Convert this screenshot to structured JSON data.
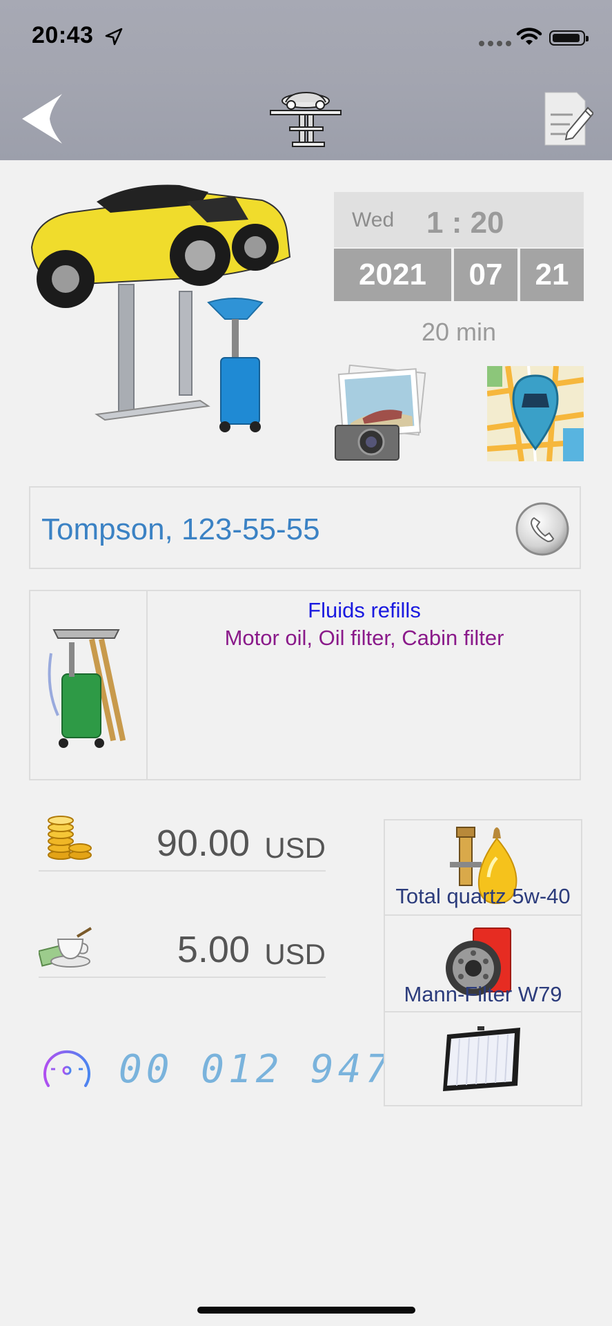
{
  "status_bar": {
    "time": "20:43"
  },
  "appointment": {
    "weekday": "Wed",
    "time": "1 : 20",
    "year": "2021",
    "month": "07",
    "day": "21",
    "duration": "20 min"
  },
  "client": {
    "label": "Tompson, 123-55-55"
  },
  "service": {
    "title": "Fluids refills",
    "items": "Motor oil, Oil filter, Cabin filter"
  },
  "pricing": {
    "cost_value": "90.00",
    "cost_currency": "USD",
    "tip_value": "5.00",
    "tip_currency": "USD"
  },
  "odometer": {
    "reading": "00 012 947"
  },
  "parts": [
    {
      "label": "Total quartz 5w-40",
      "icon": "oil-bottle-icon"
    },
    {
      "label": "Mann-Filter W79",
      "icon": "oil-filter-icon"
    },
    {
      "label": "",
      "icon": "cabin-filter-icon"
    }
  ],
  "colors": {
    "header_bg": "#a3a5b0",
    "client_text": "#3b82c4",
    "service_title": "#1a1ae0",
    "service_items": "#8a1a8a",
    "part_text": "#2c3c7c",
    "odometer": "#7ab3dc",
    "date_cell": "#a4a4a4"
  }
}
